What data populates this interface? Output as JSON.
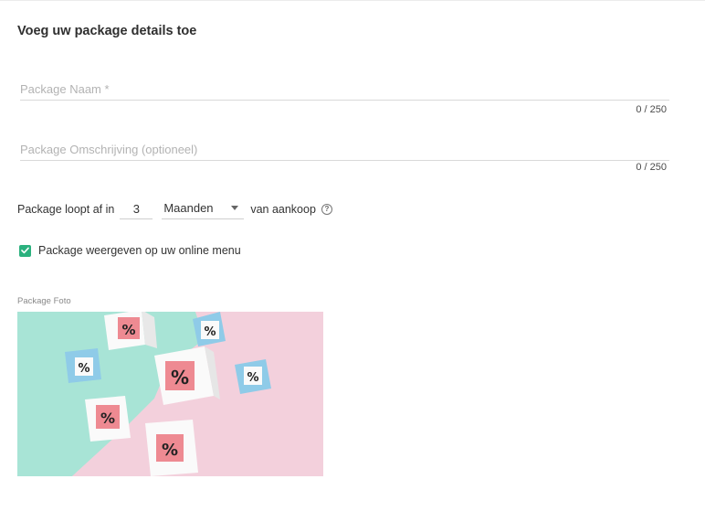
{
  "form": {
    "title": "Voeg uw package details toe",
    "name_field": {
      "placeholder": "Package Naam *",
      "value": "",
      "counter": "0 / 250"
    },
    "description_field": {
      "placeholder": "Package Omschrijving (optioneel)",
      "value": "",
      "counter": "0 / 250"
    },
    "expiry": {
      "label_before": "Package loopt af in",
      "quantity": "3",
      "unit": "Maanden",
      "label_after": "van aankoop",
      "help_icon": "question-circle-icon"
    },
    "show_online": {
      "label": "Package weergeven op uw online menu",
      "checked": true
    },
    "photo": {
      "label": "Package Foto"
    }
  },
  "colors": {
    "accent": "#2bb17e",
    "mint": "#a9e6d8",
    "pink": "#f3cfdb",
    "sticker": "#ee8a92",
    "blue_cube": "#8fcbe8"
  }
}
